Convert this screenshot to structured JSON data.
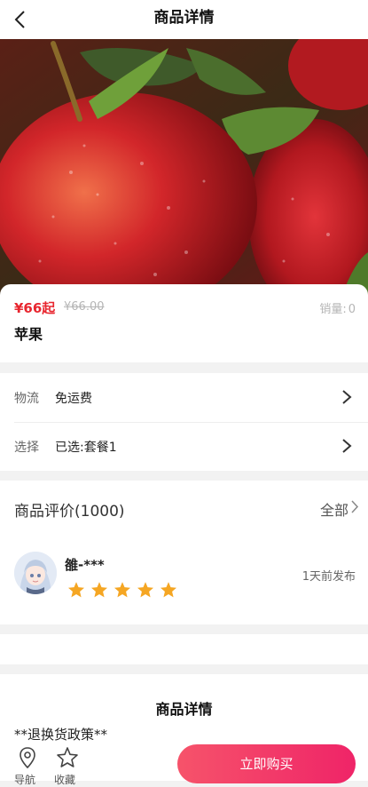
{
  "header": {
    "title": "商品详情"
  },
  "product": {
    "price": "¥66起",
    "original_price": "¥66.00",
    "sales_label": "销量:",
    "sales_value": "0",
    "name": "苹果"
  },
  "info": {
    "logistics_label": "物流",
    "logistics_value": "免运费",
    "select_label": "选择",
    "select_value": "已选:套餐1"
  },
  "reviews": {
    "title": "商品评价(1000)",
    "all_label": "全部",
    "reviewer": "雒-***",
    "rating": 5,
    "time": "1天前发布",
    "star_color": "#f5a623"
  },
  "detail": {
    "title": "商品详情",
    "policy": "**退换货政策**"
  },
  "bottom_bar": {
    "nav_label": "导航",
    "fav_label": "收藏",
    "buy_label": "立即购买"
  },
  "colors": {
    "price": "#e8262f",
    "buy_gradient_start": "#f6536a",
    "buy_gradient_end": "#ef2468"
  }
}
